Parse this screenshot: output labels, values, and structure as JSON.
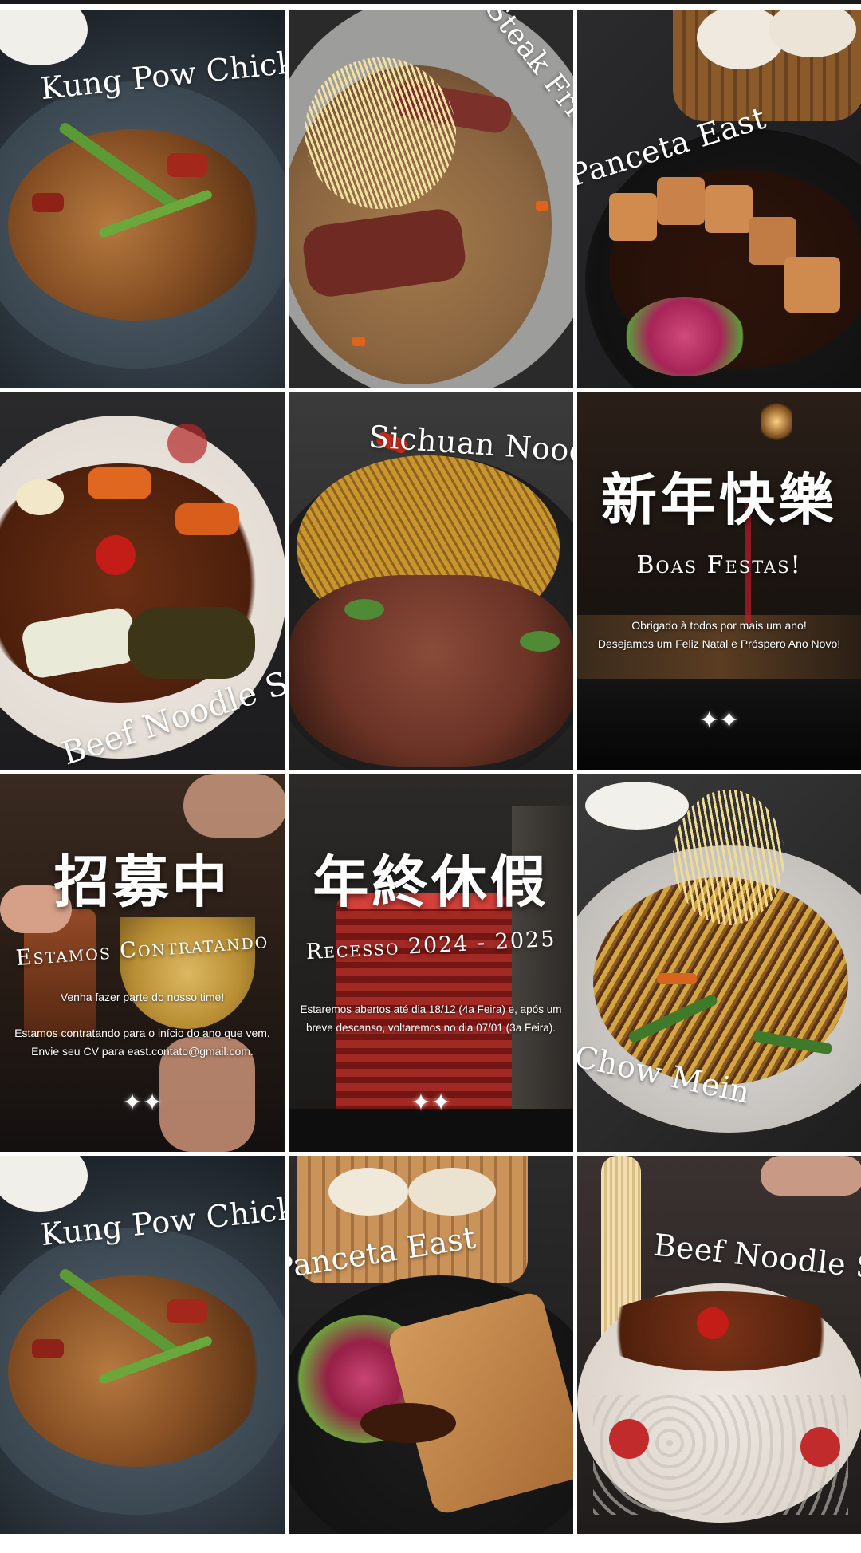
{
  "posts": [
    {
      "caption": "Kung Pow Chicken"
    },
    {
      "caption": "Steak Fried Rice"
    },
    {
      "caption": "Panceta East"
    },
    {
      "caption": "Beef Noodle Soup"
    },
    {
      "caption": "Sichuan Noodle"
    },
    {
      "headline_cjk": "新年快樂",
      "subtitle": "Boas Festas!",
      "line1": "Obrigado à todos por mais um ano!",
      "line2": "Desejamos um Feliz Natal e Próspero Ano Novo!",
      "sparkle": "✦✦"
    },
    {
      "headline_cjk": "招募中",
      "subtitle": "Estamos Contratando",
      "line1": "Venha fazer parte do nosso time!",
      "line2": "Estamos contratando para o início do ano que vem.",
      "line3": "Envie seu CV para east.contato@gmail.com.",
      "sparkle": "✦✦"
    },
    {
      "headline_cjk": "年終休假",
      "subtitle": "Recesso 2024 - 2025",
      "line1": "Estaremos abertos até dia 18/12 (4a Feira) e, após um",
      "line2": "breve descanso, voltaremos no dia 07/01 (3a Feira).",
      "sparkle": "✦✦"
    },
    {
      "caption": "Chow Mein"
    },
    {
      "caption": "Kung Pow Chicken"
    },
    {
      "caption": "Panceta East"
    },
    {
      "caption": "Beef Noodle Soup"
    }
  ],
  "colors": {
    "plate_slate": "#3d4a55",
    "dark_bg": "#1b1b1e",
    "bowl_white": "#ece7e2",
    "sauce_brown": "#7a3f1c",
    "chili_red": "#c0261e"
  }
}
